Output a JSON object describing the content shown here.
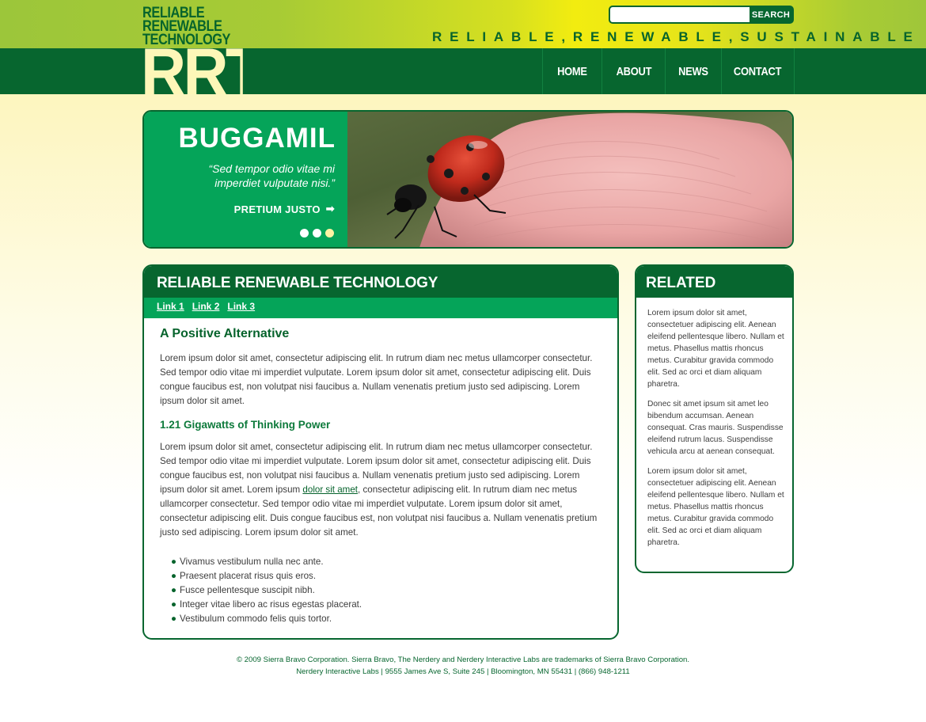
{
  "logo": {
    "lines": [
      "RELIABLE",
      "RENEWABLE",
      "TECHNOLOGY"
    ],
    "mark": "RRT"
  },
  "search": {
    "placeholder": "",
    "button_label": "SEARCH"
  },
  "tagline": "RELIABLE,RENEWABLE,SUSTAINABLE",
  "nav": {
    "items": [
      {
        "label": "HOME"
      },
      {
        "label": "ABOUT"
      },
      {
        "label": "NEWS"
      },
      {
        "label": "CONTACT"
      }
    ]
  },
  "hero": {
    "title": "BUGGAMIL",
    "quote": "“Sed tempor odio vitae mi imperdiet vulputate nisi.”",
    "cta_label": "PRETIUM JUSTO",
    "cta_arrow": "➡",
    "slides": 3,
    "active_slide": 3
  },
  "main": {
    "title": "RELIABLE RENEWABLE TECHNOLOGY",
    "links": [
      {
        "label": "Link 1"
      },
      {
        "label": "Link 2"
      },
      {
        "label": "Link 3"
      }
    ],
    "heading1": "A Positive Alternative",
    "para1": "Lorem ipsum dolor sit amet, consectetur adipiscing elit. In rutrum diam nec metus ullamcorper consectetur. Sed tempor odio vitae mi imperdiet vulputate. Lorem ipsum dolor sit amet, consectetur adipiscing elit. Duis congue faucibus est, non volutpat nisi faucibus a. Nullam venenatis pretium justo sed adipiscing. Lorem ipsum dolor sit amet.",
    "heading2": "1.21 Gigawatts of Thinking Power",
    "para2_before": "Lorem ipsum dolor sit amet, consectetur adipiscing elit. In rutrum diam nec metus ullamcorper consectetur. Sed tempor odio vitae mi imperdiet vulputate. Lorem ipsum dolor sit amet, consectetur adipiscing elit. Duis congue faucibus est, non volutpat nisi faucibus a. Nullam venenatis pretium justo sed adipiscing. Lorem ipsum dolor sit amet. Lorem ipsum ",
    "para2_link": "dolor sit amet",
    "para2_after": ", consectetur adipiscing elit. In rutrum diam nec metus ullamcorper consectetur. Sed tempor odio vitae mi imperdiet vulputate. Lorem ipsum dolor sit amet, consectetur adipiscing elit. Duis congue faucibus est, non volutpat nisi faucibus a. Nullam venenatis pretium justo sed adipiscing. Lorem ipsum dolor sit amet.",
    "bullets": [
      "Vivamus vestibulum nulla nec ante.",
      "Praesent placerat risus quis eros.",
      "Fusce pellentesque suscipit nibh.",
      "Integer vitae libero ac risus egestas placerat.",
      "Vestibulum commodo felis quis tortor."
    ]
  },
  "related": {
    "title": "RELATED",
    "paragraphs": [
      "Lorem ipsum dolor sit amet, consectetuer adipiscing elit. Aenean eleifend pellentesque libero. Nullam et metus. Phasellus mattis rhoncus metus. Curabitur gravida commodo elit. Sed ac orci et diam aliquam pharetra.",
      "Donec sit amet ipsum sit amet leo bibendum accumsan. Aenean consequat. Cras mauris. Suspendisse eleifend rutrum lacus. Suspendisse vehicula arcu at aenean consequat.",
      "Lorem ipsum dolor sit amet, consectetuer adipiscing elit. Aenean eleifend pellentesque libero. Nullam et metus. Phasellus mattis rhoncus metus. Curabitur gravida commodo elit. Sed ac orci et diam aliquam pharetra."
    ]
  },
  "footer": {
    "line1": "© 2009 Sierra Bravo Corporation. Sierra Bravo, The Nerdery and Nerdery Interactive Labs are trademarks of Sierra Bravo Corporation.",
    "line2": "Nerdery Interactive Labs | 9555 James Ave S, Suite 245 | Bloomington, MN 55431 | (866) 948-1211"
  },
  "colors": {
    "dark_green": "#07662f",
    "bright_green": "#05a459",
    "lime": "#a3c93a",
    "cream": "#fdf7b8"
  },
  "icons": {
    "cta_arrow": "arrow-right-icon",
    "bullet": "bullet-icon"
  }
}
